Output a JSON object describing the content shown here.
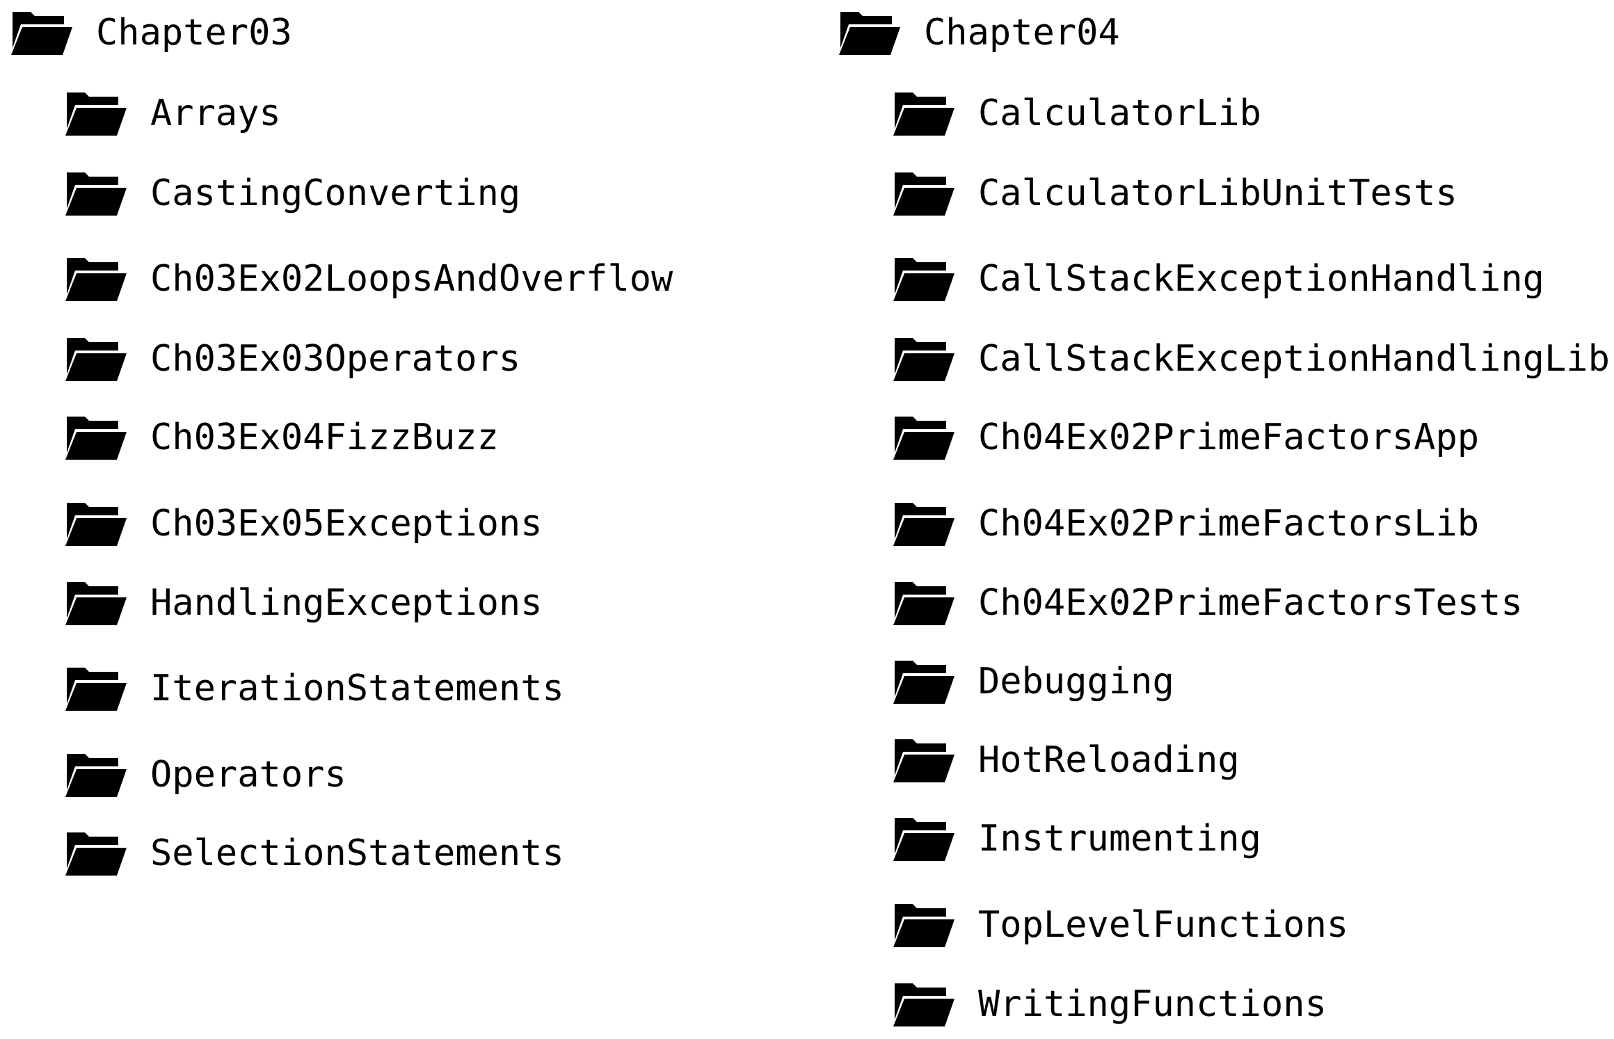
{
  "icon": "folder-open-icon",
  "left": {
    "root": "Chapter03",
    "children": [
      "Arrays",
      "CastingConverting",
      "Ch03Ex02LoopsAndOverflow",
      "Ch03Ex03Operators",
      "Ch03Ex04FizzBuzz",
      "Ch03Ex05Exceptions",
      "HandlingExceptions",
      "IterationStatements",
      "Operators",
      "SelectionStatements"
    ]
  },
  "right": {
    "root": "Chapter04",
    "children": [
      "CalculatorLib",
      "CalculatorLibUnitTests",
      "CallStackExceptionHandling",
      "CallStackExceptionHandlingLib",
      "Ch04Ex02PrimeFactorsApp",
      "Ch04Ex02PrimeFactorsLib",
      "Ch04Ex02PrimeFactorsTests",
      "Debugging",
      "HotReloading",
      "Instrumenting",
      "TopLevelFunctions",
      "WritingFunctions"
    ]
  }
}
